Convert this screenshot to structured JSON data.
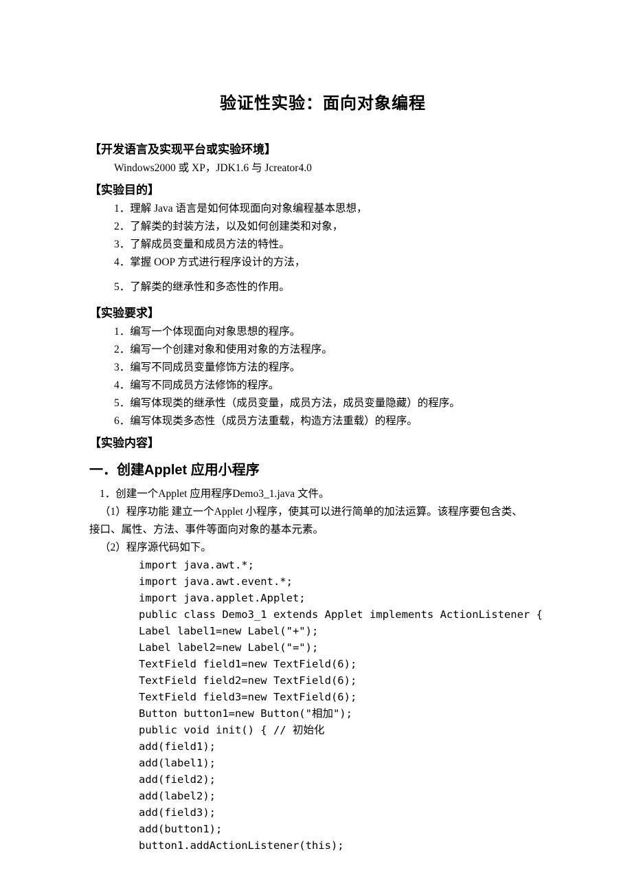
{
  "title": "验证性实验：面向对象编程",
  "sections": {
    "dev_env": {
      "header": "【开发语言及实现平台或实验环境】",
      "text": "Windows2000 或 XP，JDK1.6 与 Jcreator4.0"
    },
    "objectives": {
      "header": "【实验目的】",
      "items": [
        "1．理解 Java 语言是如何体现面向对象编程基本思想，",
        "2．了解类的封装方法，以及如何创建类和对象，",
        "3．了解成员变量和成员方法的特性。",
        "4．掌握 OOP 方式进行程序设计的方法，",
        "5．了解类的继承性和多态性的作用。"
      ]
    },
    "requirements": {
      "header": "【实验要求】",
      "items": [
        "1．编写一个体现面向对象思想的程序。",
        "2．编写一个创建对象和使用对象的方法程序。",
        "3．编写不同成员变量修饰方法的程序。",
        "4．编写不同成员方法修饰的程序。",
        "5．编写体现类的继承性（成员变量，成员方法，成员变量隐藏）的程序。",
        "6．编写体现类多态性（成员方法重载，构造方法重载）的程序。"
      ]
    },
    "content": {
      "header": "【实验内容】",
      "subsection_title": "一．创建Applet 应用小程序",
      "step1": "1．创建一个Applet 应用程序Demo3_1.java 文件。",
      "desc1a": "（1）程序功能 建立一个Applet 小程序，使其可以进行简单的加法运算。该程序要包含类、",
      "desc1b": "接口、属性、方法、事件等面向对象的基本元素。",
      "desc2": "（2）程序源代码如下。",
      "code": [
        "import java.awt.*;",
        "import java.awt.event.*;",
        "import java.applet.Applet;",
        "public class Demo3_1 extends Applet implements ActionListener {",
        "Label label1=new Label(\"+\");",
        "Label label2=new Label(\"=\");",
        "TextField field1=new TextField(6);",
        "TextField field2=new TextField(6);",
        "TextField field3=new TextField(6);",
        "Button button1=new Button(\"相加\");",
        "public void init() { // 初始化",
        "add(field1);",
        "add(label1);",
        "add(field2);",
        "add(label2);",
        "add(field3);",
        "add(button1);",
        "button1.addActionListener(this);"
      ]
    }
  }
}
